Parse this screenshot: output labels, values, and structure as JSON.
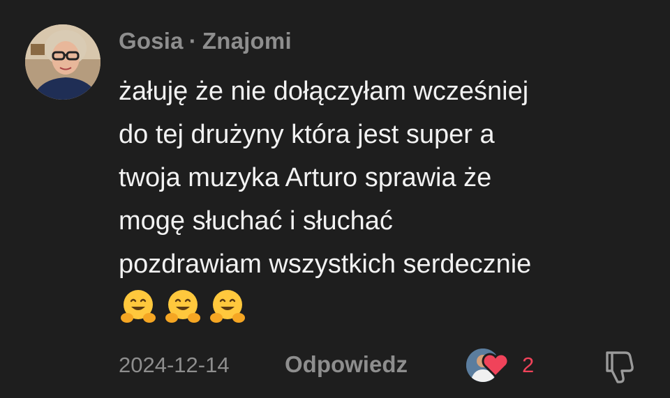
{
  "comment": {
    "author": "Gosia",
    "separator": "·",
    "relation": "Znajomi",
    "lines": [
      "żałuję że nie dołączyłam wcześniej",
      "do tej drużyny która jest super a",
      "twoja muzyka Arturo sprawia że",
      "mogę słuchać i słuchać",
      "pozdrawiam wszystkich serdecznie"
    ],
    "emojis": [
      "hugging-face",
      "hugging-face",
      "hugging-face"
    ],
    "date": "2024-12-14",
    "reply_label": "Odpowiedz",
    "like_count": "2"
  },
  "colors": {
    "background": "#1e1e1e",
    "text": "#f2f2f2",
    "muted": "#8e8e8e",
    "like": "#f0435a"
  }
}
